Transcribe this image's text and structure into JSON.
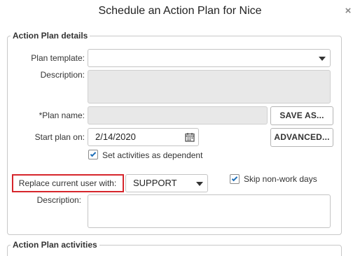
{
  "dialog": {
    "title": "Schedule an Action Plan for Nice",
    "close_icon": "×"
  },
  "details_section": {
    "legend": "Action Plan details",
    "plan_template": {
      "label": "Plan template:",
      "value": ""
    },
    "description": {
      "label": "Description:",
      "value": ""
    },
    "plan_name": {
      "label": "*Plan name:",
      "value": ""
    },
    "save_as_button": "SAVE AS...",
    "start_plan": {
      "label": "Start plan on:",
      "value": "2/14/2020"
    },
    "advanced_button": "ADVANCED...",
    "set_dependent": {
      "label": "Set activities as dependent",
      "checked": true
    },
    "replace_user": {
      "label": "Replace current user with:",
      "value": "SUPPORT"
    },
    "skip_nonwork": {
      "label": "Skip non-work days",
      "checked": true
    },
    "description2": {
      "label": "Description:",
      "value": ""
    }
  },
  "activities_section": {
    "legend": "Action Plan activities"
  },
  "colors": {
    "highlight": "#d6262c",
    "checkmark": "#1f6fb8",
    "disabled_bg": "#e8e8e8"
  }
}
